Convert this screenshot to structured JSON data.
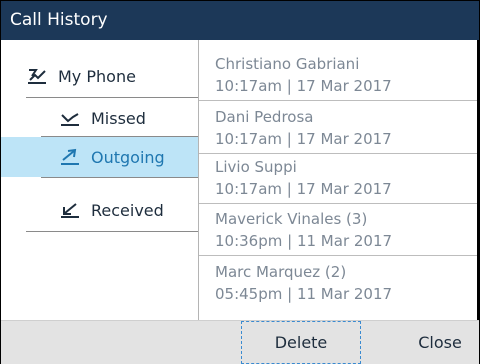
{
  "window": {
    "title": "Call History"
  },
  "nav": {
    "items": [
      {
        "label": "My Phone",
        "icon": "all-calls-icon"
      },
      {
        "label": "Missed",
        "icon": "missed-call-icon"
      },
      {
        "label": "Outgoing",
        "icon": "outgoing-call-icon",
        "selected": true
      },
      {
        "label": "Received",
        "icon": "received-call-icon"
      }
    ]
  },
  "calls": [
    {
      "name": "Christiano Gabriani",
      "time": "10:17am | 17 Mar 2017"
    },
    {
      "name": "Dani Pedrosa",
      "time": "10:17am | 17 Mar 2017"
    },
    {
      "name": "Livio Suppi",
      "time": "10:17am | 17 Mar 2017"
    },
    {
      "name": "Maverick Vinales (3)",
      "time": "10:36pm | 11 Mar 2017"
    },
    {
      "name": "Marc Marquez (2)",
      "time": "05:45pm | 11 Mar 2017"
    }
  ],
  "softkeys": {
    "delete": "Delete",
    "close": "Close"
  },
  "colors": {
    "titlebar": "#1c3858",
    "selected_bg": "#bde4f7",
    "selected_text": "#1f77b0",
    "softkey_bar": "#e3e3e3"
  }
}
